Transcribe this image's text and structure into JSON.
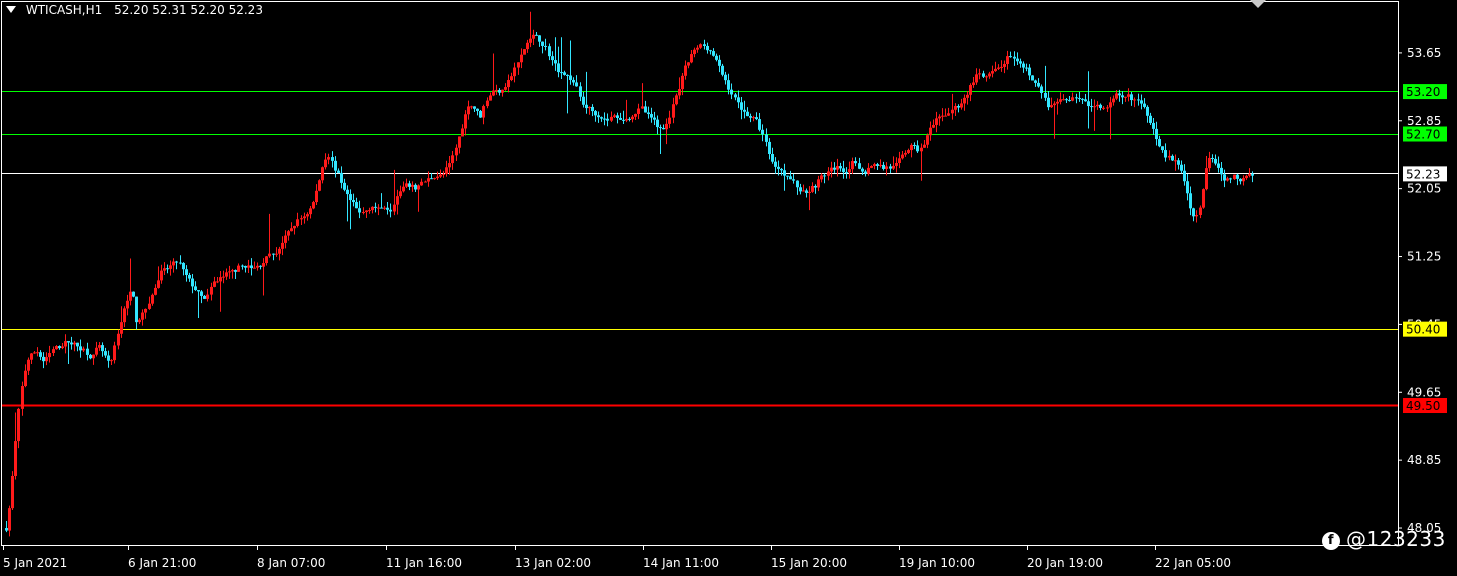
{
  "header": {
    "symbol": "WTICASH,H1",
    "ohlc": "52.20 52.31 52.20 52.23"
  },
  "watermark": {
    "text": "@123233"
  },
  "colors": {
    "background": "#000000",
    "bull": "#ff1a1a",
    "bear": "#33e6ff",
    "frame": "#ffffff",
    "green_level": "#00ff00",
    "yellow_level": "#ffff00",
    "red_level": "#ff0000",
    "current_level": "#ffffff"
  },
  "chart_data": {
    "type": "candlestick",
    "ylim": [
      47.85,
      54.25
    ],
    "y_ticks": [
      "53.65",
      "52.85",
      "52.05",
      "51.25",
      "50.45",
      "49.65",
      "48.85",
      "48.05"
    ],
    "x_ticks": [
      "5 Jan 2021",
      "6 Jan 21:00",
      "8 Jan 07:00",
      "11 Jan 16:00",
      "13 Jan 02:00",
      "14 Jan 11:00",
      "15 Jan 20:00",
      "19 Jan 10:00",
      "20 Jan 19:00",
      "22 Jan 05:00"
    ],
    "levels": [
      {
        "value": 53.2,
        "label": "53.20",
        "color": "#00ff00"
      },
      {
        "value": 52.7,
        "label": "52.70",
        "color": "#00ff00"
      },
      {
        "value": 52.23,
        "label": "52.23",
        "color": "#ffffff"
      },
      {
        "value": 50.4,
        "label": "50.40",
        "color": "#ffff00"
      },
      {
        "value": 49.5,
        "label": "49.50",
        "color": "#ff0000"
      }
    ],
    "close_path": [
      [
        0,
        48.05
      ],
      [
        4,
        48.35
      ],
      [
        8,
        48.9
      ],
      [
        12,
        49.4
      ],
      [
        17,
        49.85
      ],
      [
        22,
        50.05
      ],
      [
        30,
        50.15
      ],
      [
        38,
        50.0
      ],
      [
        46,
        50.15
      ],
      [
        54,
        50.2
      ],
      [
        62,
        50.25
      ],
      [
        70,
        50.2
      ],
      [
        78,
        50.15
      ],
      [
        86,
        50.05
      ],
      [
        92,
        50.2
      ],
      [
        98,
        50.1
      ],
      [
        104,
        49.95
      ],
      [
        110,
        50.25
      ],
      [
        116,
        50.55
      ],
      [
        122,
        50.8
      ],
      [
        126,
        50.85
      ],
      [
        130,
        50.5
      ],
      [
        136,
        50.55
      ],
      [
        142,
        50.7
      ],
      [
        148,
        50.85
      ],
      [
        154,
        51.05
      ],
      [
        160,
        51.1
      ],
      [
        166,
        51.15
      ],
      [
        172,
        51.2
      ],
      [
        178,
        51.05
      ],
      [
        184,
        50.95
      ],
      [
        190,
        50.85
      ],
      [
        196,
        50.75
      ],
      [
        202,
        50.8
      ],
      [
        208,
        50.95
      ],
      [
        214,
        51.0
      ],
      [
        222,
        51.05
      ],
      [
        230,
        51.1
      ],
      [
        238,
        51.15
      ],
      [
        246,
        51.1
      ],
      [
        254,
        51.15
      ],
      [
        262,
        51.25
      ],
      [
        270,
        51.3
      ],
      [
        278,
        51.45
      ],
      [
        286,
        51.6
      ],
      [
        294,
        51.7
      ],
      [
        300,
        51.75
      ],
      [
        306,
        51.85
      ],
      [
        312,
        52.1
      ],
      [
        318,
        52.4
      ],
      [
        322,
        52.45
      ],
      [
        326,
        52.35
      ],
      [
        330,
        52.25
      ],
      [
        336,
        52.1
      ],
      [
        342,
        51.95
      ],
      [
        348,
        51.85
      ],
      [
        354,
        51.75
      ],
      [
        360,
        51.8
      ],
      [
        366,
        51.85
      ],
      [
        372,
        51.8
      ],
      [
        378,
        51.85
      ],
      [
        384,
        51.8
      ],
      [
        390,
        51.95
      ],
      [
        396,
        52.05
      ],
      [
        402,
        52.1
      ],
      [
        408,
        52.05
      ],
      [
        414,
        52.1
      ],
      [
        420,
        52.15
      ],
      [
        428,
        52.2
      ],
      [
        436,
        52.2
      ],
      [
        444,
        52.35
      ],
      [
        450,
        52.55
      ],
      [
        456,
        52.8
      ],
      [
        462,
        53.05
      ],
      [
        468,
        53.0
      ],
      [
        474,
        52.9
      ],
      [
        480,
        53.1
      ],
      [
        486,
        53.2
      ],
      [
        492,
        53.2
      ],
      [
        498,
        53.25
      ],
      [
        504,
        53.35
      ],
      [
        510,
        53.5
      ],
      [
        516,
        53.65
      ],
      [
        522,
        53.8
      ],
      [
        528,
        53.85
      ],
      [
        534,
        53.8
      ],
      [
        540,
        53.7
      ],
      [
        546,
        53.55
      ],
      [
        552,
        53.45
      ],
      [
        558,
        53.4
      ],
      [
        564,
        53.35
      ],
      [
        570,
        53.25
      ],
      [
        576,
        53.05
      ],
      [
        582,
        53.0
      ],
      [
        588,
        52.95
      ],
      [
        594,
        52.9
      ],
      [
        600,
        52.85
      ],
      [
        606,
        52.9
      ],
      [
        612,
        52.9
      ],
      [
        618,
        52.85
      ],
      [
        624,
        52.9
      ],
      [
        630,
        52.95
      ],
      [
        636,
        53.0
      ],
      [
        642,
        52.9
      ],
      [
        648,
        52.85
      ],
      [
        654,
        52.75
      ],
      [
        660,
        52.8
      ],
      [
        666,
        53.0
      ],
      [
        672,
        53.2
      ],
      [
        678,
        53.45
      ],
      [
        684,
        53.6
      ],
      [
        690,
        53.7
      ],
      [
        696,
        53.75
      ],
      [
        702,
        53.7
      ],
      [
        708,
        53.6
      ],
      [
        714,
        53.45
      ],
      [
        720,
        53.3
      ],
      [
        726,
        53.15
      ],
      [
        732,
        53.05
      ],
      [
        738,
        52.95
      ],
      [
        744,
        52.9
      ],
      [
        750,
        52.85
      ],
      [
        756,
        52.7
      ],
      [
        762,
        52.5
      ],
      [
        768,
        52.3
      ],
      [
        774,
        52.3
      ],
      [
        780,
        52.2
      ],
      [
        786,
        52.15
      ],
      [
        792,
        52.05
      ],
      [
        798,
        52.0
      ],
      [
        804,
        52.05
      ],
      [
        810,
        52.1
      ],
      [
        816,
        52.2
      ],
      [
        822,
        52.25
      ],
      [
        828,
        52.3
      ],
      [
        834,
        52.3
      ],
      [
        840,
        52.25
      ],
      [
        846,
        52.35
      ],
      [
        852,
        52.3
      ],
      [
        858,
        52.25
      ],
      [
        864,
        52.3
      ],
      [
        870,
        52.35
      ],
      [
        876,
        52.3
      ],
      [
        882,
        52.3
      ],
      [
        888,
        52.3
      ],
      [
        894,
        52.4
      ],
      [
        900,
        52.5
      ],
      [
        906,
        52.55
      ],
      [
        912,
        52.5
      ],
      [
        918,
        52.6
      ],
      [
        924,
        52.75
      ],
      [
        930,
        52.85
      ],
      [
        936,
        52.9
      ],
      [
        942,
        52.95
      ],
      [
        948,
        53.0
      ],
      [
        954,
        53.05
      ],
      [
        960,
        53.15
      ],
      [
        966,
        53.3
      ],
      [
        972,
        53.4
      ],
      [
        978,
        53.35
      ],
      [
        984,
        53.4
      ],
      [
        990,
        53.45
      ],
      [
        996,
        53.5
      ],
      [
        1002,
        53.6
      ],
      [
        1008,
        53.55
      ],
      [
        1014,
        53.5
      ],
      [
        1020,
        53.45
      ],
      [
        1026,
        53.35
      ],
      [
        1032,
        53.25
      ],
      [
        1038,
        53.1
      ],
      [
        1044,
        53.0
      ],
      [
        1050,
        53.05
      ],
      [
        1056,
        53.1
      ],
      [
        1062,
        53.1
      ],
      [
        1068,
        53.15
      ],
      [
        1074,
        53.1
      ],
      [
        1080,
        53.05
      ],
      [
        1086,
        53.0
      ],
      [
        1092,
        53.05
      ],
      [
        1098,
        53.0
      ],
      [
        1104,
        53.05
      ],
      [
        1110,
        53.15
      ],
      [
        1116,
        53.1
      ],
      [
        1122,
        53.15
      ],
      [
        1128,
        53.1
      ],
      [
        1134,
        53.05
      ],
      [
        1140,
        52.95
      ],
      [
        1146,
        52.8
      ],
      [
        1152,
        52.6
      ],
      [
        1158,
        52.45
      ],
      [
        1164,
        52.4
      ],
      [
        1170,
        52.35
      ],
      [
        1176,
        52.25
      ],
      [
        1180,
        52.05
      ],
      [
        1184,
        51.85
      ],
      [
        1188,
        51.7
      ],
      [
        1192,
        51.75
      ],
      [
        1196,
        52.0
      ],
      [
        1200,
        52.3
      ],
      [
        1204,
        52.45
      ],
      [
        1208,
        52.4
      ],
      [
        1212,
        52.3
      ],
      [
        1216,
        52.2
      ],
      [
        1220,
        52.15
      ],
      [
        1226,
        52.2
      ],
      [
        1232,
        52.15
      ],
      [
        1238,
        52.2
      ],
      [
        1244,
        52.25
      ],
      [
        1250,
        52.2
      ],
      [
        1254,
        52.23
      ]
    ]
  }
}
